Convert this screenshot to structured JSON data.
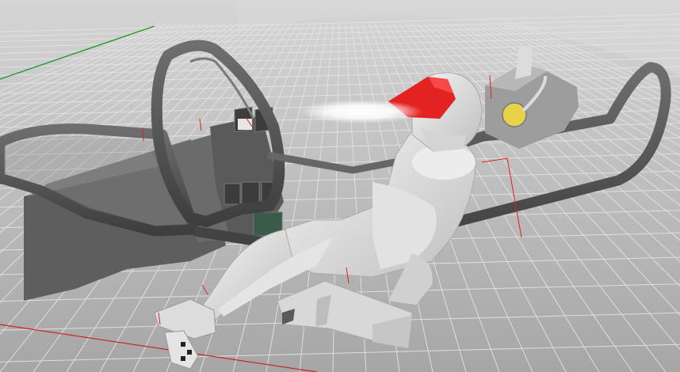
{
  "viewport": {
    "view": "perspective",
    "display_mode": "shaded",
    "grid": true,
    "axes": {
      "x_axis_color": "#c8221f",
      "y_axis_color": "#1f9b2a"
    }
  },
  "colors": {
    "background_top": "#d6d6d6",
    "background_bottom": "#a8a8a8",
    "grid_line": "#e6e6e6",
    "canopy_frame": "#555555",
    "pilot_body": "#e9e9e9",
    "helmet_stripe": "#e32222",
    "visor_glow": "#ffffff",
    "display_screen": "#3c3c3c",
    "display_screen_lit": "#3a5a4a",
    "gauge_dial": "#e8d24a",
    "seat": "#dcdcdc",
    "selection_marker": "#e02020"
  },
  "scene": {
    "objects": [
      "canopy-frame",
      "cockpit-tub",
      "instrument-panel",
      "pilot-figure",
      "pilot-helmet",
      "ejection-seat",
      "rudder-pedal",
      "rear-gauge-box"
    ]
  }
}
